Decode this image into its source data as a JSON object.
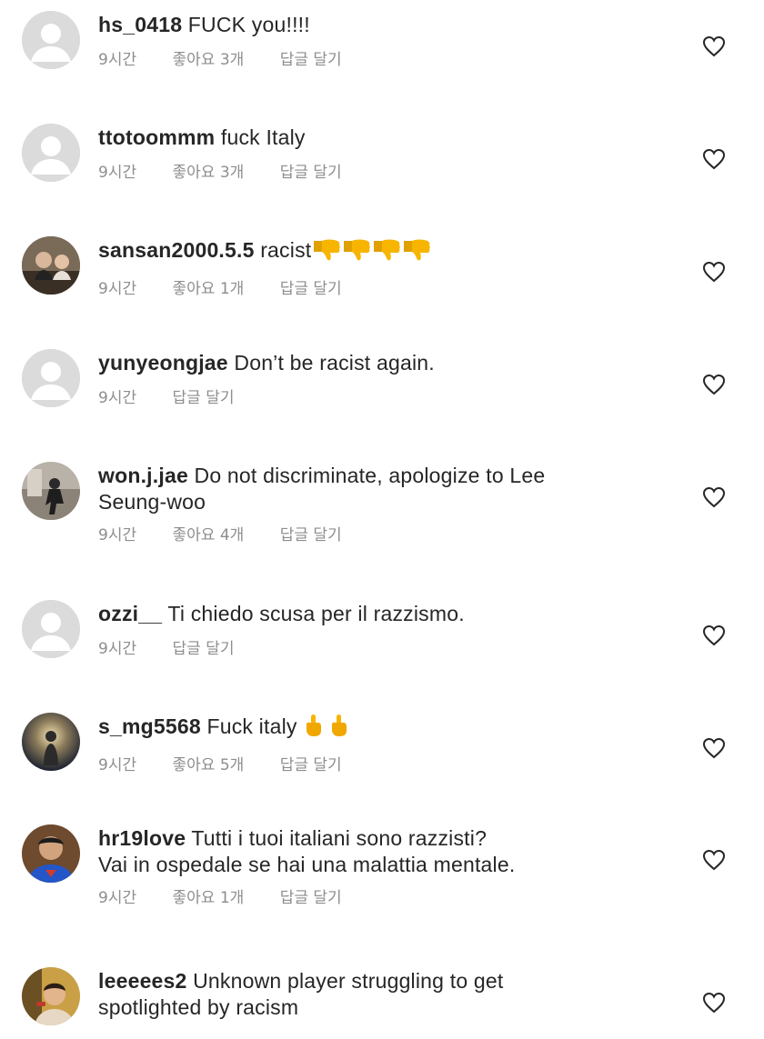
{
  "comments": [
    {
      "username": "hs_0418",
      "text": "FUCK you!!!!",
      "time": "9시간",
      "likes": "좋아요 3개",
      "reply": "답글 달기",
      "avatar": "default-avatar-icon"
    },
    {
      "username": "ttotoommm",
      "text": "fuck Italy",
      "time": "9시간",
      "likes": "좋아요 3개",
      "reply": "답글 달기",
      "avatar": "default-avatar-icon"
    },
    {
      "username": "sansan2000.5.5",
      "text": "racist",
      "emoji": "thumbs-down-icon x4",
      "time": "9시간",
      "likes": "좋아요 1개",
      "reply": "답글 달기",
      "avatar": "photo-avatar"
    },
    {
      "username": "yunyeongjae",
      "text": "Don’t be racist again.",
      "time": "9시간",
      "reply": "답글 달기",
      "avatar": "default-avatar-icon"
    },
    {
      "username": "won.j.jae",
      "text": "Do not discriminate, apologize to Lee",
      "text2": "Seung-woo",
      "time": "9시간",
      "likes": "좋아요 4개",
      "reply": "답글 달기",
      "avatar": "photo-avatar"
    },
    {
      "username": "ozzi__",
      "text": "Ti chiedo scusa per il razzismo.",
      "time": "9시간",
      "reply": "답글 달기",
      "avatar": "default-avatar-icon"
    },
    {
      "username": "s_mg5568",
      "text": "Fuck italy",
      "emoji": "middle-finger-icon x2",
      "time": "9시간",
      "likes": "좋아요 5개",
      "reply": "답글 달기",
      "avatar": "photo-avatar"
    },
    {
      "username": "hr19love",
      "text": "Tutti i tuoi italiani sono razzisti?",
      "text2": "Vai in ospedale se hai una malattia mentale.",
      "time": "9시간",
      "likes": "좋아요 1개",
      "reply": "답글 달기",
      "avatar": "photo-avatar"
    },
    {
      "username": "leeeees2",
      "text": "Unknown player struggling to get",
      "text2": "spotlighted by racism",
      "avatar": "photo-avatar"
    }
  ],
  "colors": {
    "text": "#262626",
    "meta": "#8e8e8e",
    "avatar_bg": "#dbdbdb",
    "emoji": "#f7b500"
  }
}
